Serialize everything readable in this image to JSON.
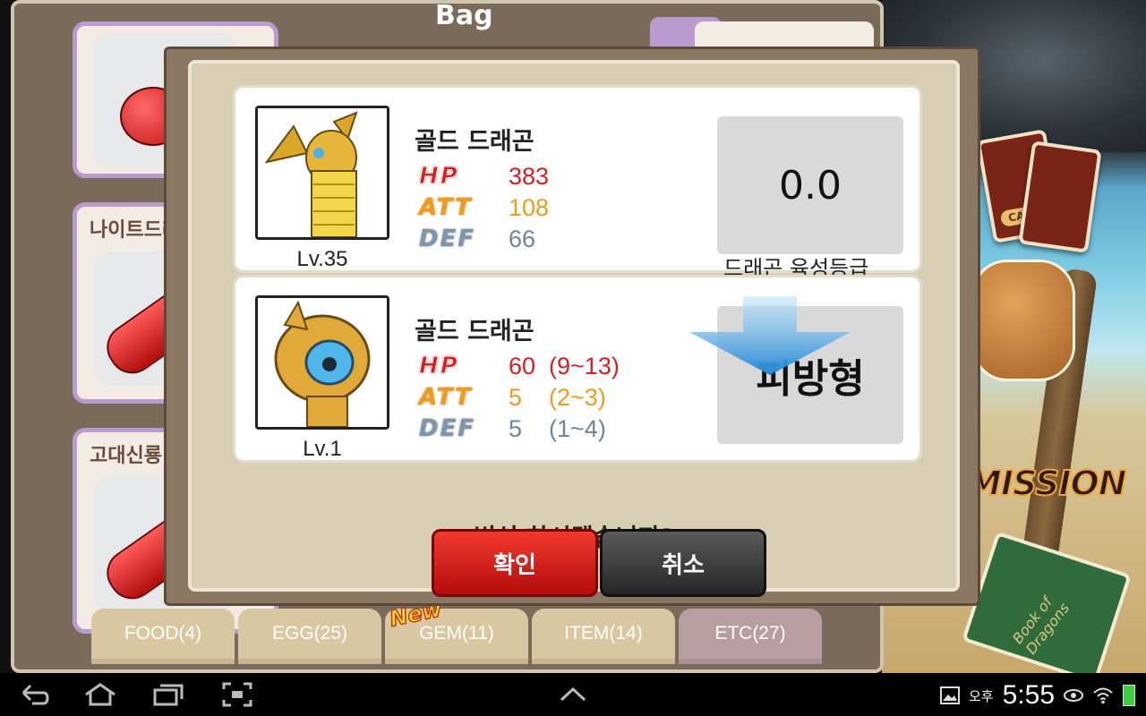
{
  "bag": {
    "title": "Bag",
    "close_symbol": "✕",
    "slots": [
      {
        "name": ""
      },
      {
        "name": "나이트드래"
      },
      {
        "name": "고대신룡"
      }
    ],
    "tabs": [
      {
        "label": "FOOD(4)"
      },
      {
        "label": "EGG(25)"
      },
      {
        "label": "GEM(11)"
      },
      {
        "label": "ITEM(14)"
      },
      {
        "label": "ETC(27)"
      }
    ],
    "new_badge": "New"
  },
  "scene": {
    "card_label": "CARD",
    "mission_text": "MISSION",
    "book_text": "Book of Dragons"
  },
  "dialog": {
    "before": {
      "name": "골드 드래곤",
      "level": "Lv.35",
      "stats": {
        "hp": "383",
        "att": "108",
        "def": "66"
      },
      "grade_value": "0.0",
      "grade_caption": "드래곤 육성등급"
    },
    "after": {
      "name": "골드 드래곤",
      "level": "Lv.1",
      "stats": {
        "hp": "60  (9~13)",
        "att": "5    (2~3)",
        "def": "5    (1~4)"
      },
      "type_label": "피방형"
    },
    "stat_labels": {
      "hp": "HP",
      "att": "ATT",
      "def": "DEF"
    },
    "question": "변신 하시겠습니까?",
    "confirm_label": "확인",
    "cancel_label": "취소"
  },
  "system": {
    "ampm": "오후",
    "time": "5:55"
  },
  "colors": {
    "hp": "#d91f1f",
    "att": "#f09a1e",
    "def": "#7f95a8",
    "confirm": "#d8201a",
    "cancel": "#3a3a3a"
  }
}
